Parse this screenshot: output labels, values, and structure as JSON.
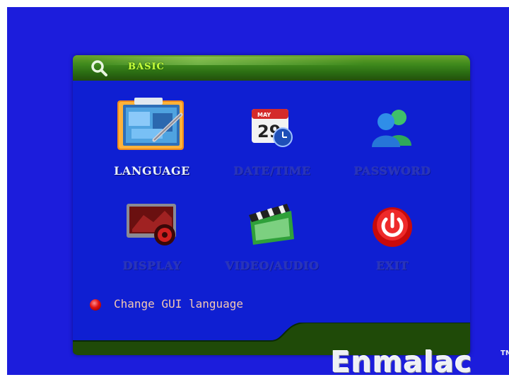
{
  "panel": {
    "title": "BASIC"
  },
  "menu": {
    "items": [
      {
        "label": "LANGUAGE",
        "icon": "language-icon"
      },
      {
        "label": "DATE/TIME",
        "icon": "calendar-clock-icon",
        "calendar_month": "MAY",
        "calendar_day": "29"
      },
      {
        "label": "PASSWORD",
        "icon": "users-icon"
      },
      {
        "label": "DISPLAY",
        "icon": "display-settings-icon"
      },
      {
        "label": "VIDEO/AUDIO",
        "icon": "clapperboard-icon"
      },
      {
        "label": "EXIT",
        "icon": "power-icon"
      }
    ],
    "selected": "LANGUAGE"
  },
  "status": {
    "text": "Change GUI language"
  },
  "brand": {
    "name": "Enmalac",
    "tm": "TM"
  },
  "colors": {
    "background": "#1c1ddc",
    "panel": "#0f1fd2",
    "title_bar": "#3f8a1d",
    "bottom_bar": "#1f4a08",
    "title_text": "#c6ff3c"
  }
}
